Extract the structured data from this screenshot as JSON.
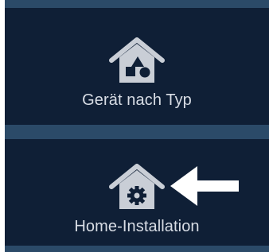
{
  "tiles": [
    {
      "label": "Gerät nach Typ",
      "icon": "house-shapes-icon"
    },
    {
      "label": "Home-Installation",
      "icon": "house-gear-icon"
    }
  ],
  "pointer": {
    "icon": "left-arrow-icon"
  },
  "colors": {
    "panel_bg": "#0f1f36",
    "separator": "#2b4a68",
    "icon": "#c9ced6",
    "label": "#d8dde5",
    "arrow": "#ffffff"
  }
}
